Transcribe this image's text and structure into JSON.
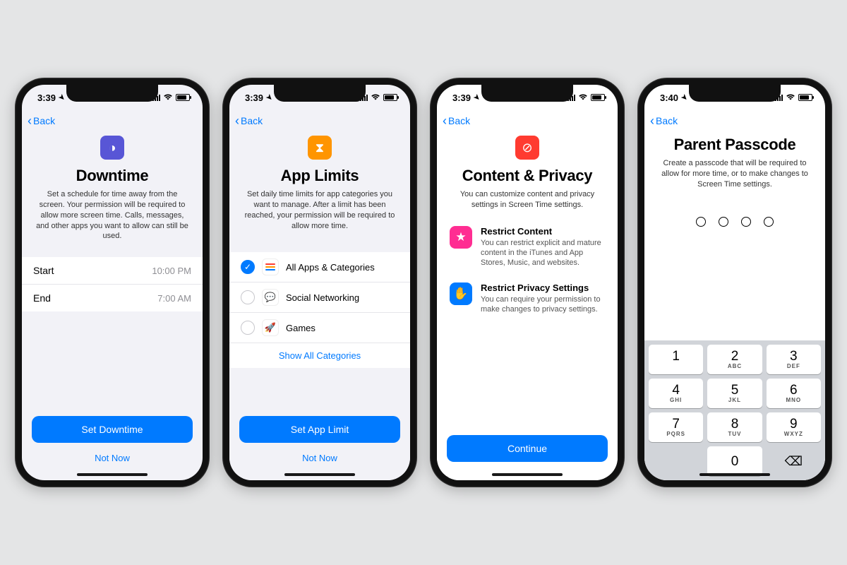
{
  "statusbar": {
    "time1": "3:39",
    "time4": "3:40"
  },
  "nav": {
    "back": "Back"
  },
  "screen1": {
    "title": "Downtime",
    "desc": "Set a schedule for time away from the screen. Your permission will be required to allow more screen time. Calls, messages, and other apps you want to allow can still be used.",
    "startLabel": "Start",
    "startValue": "10:00 PM",
    "endLabel": "End",
    "endValue": "7:00 AM",
    "primary": "Set Downtime",
    "secondary": "Not Now"
  },
  "screen2": {
    "title": "App Limits",
    "desc": "Set daily time limits for app categories you want to manage. After a limit has been reached, your permission will be required to allow more time.",
    "cat1": "All Apps & Categories",
    "cat2": "Social Networking",
    "cat3": "Games",
    "showAll": "Show All Categories",
    "primary": "Set App Limit",
    "secondary": "Not Now"
  },
  "screen3": {
    "title": "Content & Privacy",
    "desc": "You can customize content and privacy settings in Screen Time settings.",
    "f1title": "Restrict Content",
    "f1desc": "You can restrict explicit and mature content in the iTunes and App Stores, Music, and websites.",
    "f2title": "Restrict Privacy Settings",
    "f2desc": "You can require your permission to make changes to privacy settings.",
    "primary": "Continue"
  },
  "screen4": {
    "title": "Parent Passcode",
    "desc": "Create a passcode that will be required to allow for more time, or to make changes to Screen Time settings."
  },
  "keypad": {
    "k1": "1",
    "k2": "2",
    "k2l": "ABC",
    "k3": "3",
    "k3l": "DEF",
    "k4": "4",
    "k4l": "GHI",
    "k5": "5",
    "k5l": "JKL",
    "k6": "6",
    "k6l": "MNO",
    "k7": "7",
    "k7l": "PQRS",
    "k8": "8",
    "k8l": "TUV",
    "k9": "9",
    "k9l": "WXYZ",
    "k0": "0"
  }
}
